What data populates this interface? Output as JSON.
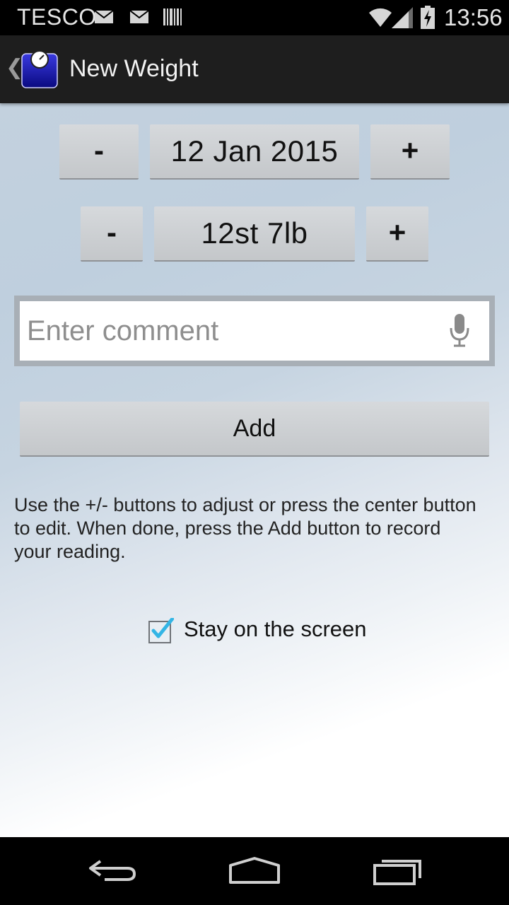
{
  "status_bar": {
    "carrier": "TESCO",
    "time": "13:56",
    "icons": [
      "mail-icon",
      "mail-icon",
      "barcode-icon",
      "wifi-icon",
      "signal-icon",
      "battery-charging-icon"
    ]
  },
  "action_bar": {
    "title": "New Weight",
    "back_icon": "chevron-left-icon",
    "app_icon": "scale-icon"
  },
  "date_row": {
    "decrement_label": "-",
    "value": "12 Jan 2015",
    "increment_label": "+"
  },
  "weight_row": {
    "decrement_label": "-",
    "value": "12st 7lb",
    "increment_label": "+"
  },
  "comment": {
    "value": "",
    "placeholder": "Enter comment",
    "voice_icon": "microphone-icon"
  },
  "add_button": {
    "label": "Add"
  },
  "help_text": "Use the +/- buttons to adjust or press the center button to edit. When done, press the Add button to record your reading.",
  "stay_on_screen": {
    "label": "Stay on the screen",
    "checked": true
  },
  "nav_bar": {
    "icons": [
      "back-icon",
      "home-icon",
      "recent-apps-icon"
    ]
  },
  "colors": {
    "accent": "#33b5e5",
    "app_icon": "#1a1aa0",
    "action_bar": "#1e1e1e"
  }
}
